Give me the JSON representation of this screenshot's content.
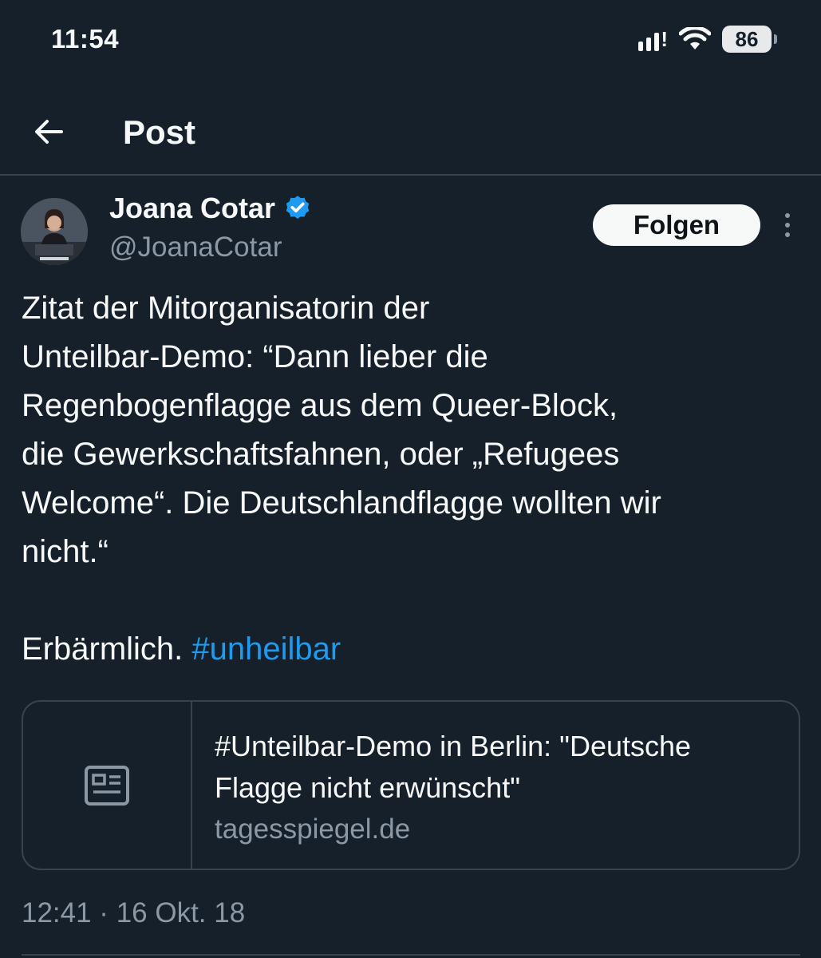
{
  "status_bar": {
    "time": "11:54",
    "battery": "86",
    "icons": [
      "signal-icon",
      "wifi-icon",
      "battery-icon"
    ]
  },
  "header": {
    "title": "Post",
    "back_icon": "arrow-left-icon"
  },
  "post": {
    "author_name": "Joana Cotar",
    "author_handle": "@JoanaCotar",
    "verified": true,
    "follow_label": "Folgen",
    "text_lines": [
      "Zitat der Mitorganisatorin der",
      "Unteilbar-Demo: “Dann lieber die",
      "Regenbogenflagge aus dem Queer-Block,",
      "die Gewerkschaftsfahnen, oder „Refugees",
      "Welcome“. Die Deutschlandflagge wollten wir",
      "nicht.“"
    ],
    "closing_text": "Erbärmlich.",
    "hashtag": "#unheilbar",
    "link_card": {
      "title_lines": [
        "#Unteilbar-Demo in Berlin: \"Deutsche",
        "Flagge nicht erwünscht\""
      ],
      "domain": "tagesspiegel.de",
      "icon": "article-icon"
    },
    "timestamp": "12:41 · 16 Okt. 18"
  },
  "colors": {
    "background": "#15202b",
    "text": "#f7f9f9",
    "secondary_text": "#8b98a5",
    "accent": "#1d9bf0",
    "border": "#38444d"
  }
}
